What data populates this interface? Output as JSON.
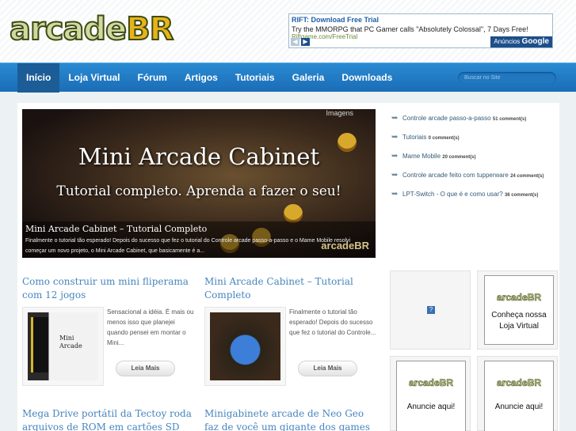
{
  "ad": {
    "title": "RIFT: Download Free Trial",
    "text": "Try the MMORPG that PC Gamer calls \"Absolutely Colossal\", 7 Days Free!",
    "url": "Riftgame.com/FreeTrial",
    "badge_prefix": "Anúncios",
    "badge_brand": "Google"
  },
  "logo": {
    "text_a": "arcade",
    "text_b": "BR"
  },
  "nav": {
    "items": [
      "Início",
      "Loja Virtual",
      "Fórum",
      "Artigos",
      "Tutoriais",
      "Galeria",
      "Downloads"
    ],
    "active_index": 0,
    "search_placeholder": "Buscar no Site"
  },
  "slider": {
    "tag": "Imagens",
    "headline": "Mini Arcade Cabinet",
    "subheadline": "Tutorial completo. Aprenda a fazer o seu!",
    "caption_title": "Mini Arcade Cabinet – Tutorial Completo",
    "caption_text": "Finalmente o tutorial tão esperado! Depois do sucesso que fez o tutorial do Controle arcade passo-a-passo e o Mame Mobile resolvi começar um novo projeto, o Mini Arcade Cabinet, que basicamente é a...",
    "watermark": "arcadeBR"
  },
  "recent": [
    {
      "title": "Controle arcade passo-a-passo",
      "comments": "51 comment(s)"
    },
    {
      "title": "Tutoriais",
      "comments": "0 comment(s)"
    },
    {
      "title": "Mame Mobile",
      "comments": "20 comment(s)"
    },
    {
      "title": "Controle arcade feito com tupperware",
      "comments": "24 comment(s)"
    },
    {
      "title": "LPT-Switch - O que é e como usar?",
      "comments": "36 comment(s)"
    }
  ],
  "posts": [
    {
      "title": "Como construir um mini fliperama com 12 jogos",
      "excerpt": "Sensacional a idéia. É mais ou menos isso que planejei quando pensei em montar o Mini...",
      "more": "Leia Mais",
      "thumb_text": "Mini Arcade"
    },
    {
      "title": "Mini Arcade Cabinet – Tutorial Completo",
      "excerpt": "Finalmente o tutorial tão esperado! Depois do sucesso que fez o tutorial do Controle...",
      "more": "Leia Mais"
    }
  ],
  "more_posts": [
    {
      "title": "Mega Drive portátil da Tectoy roda arquivos de ROM em cartões SD"
    },
    {
      "title": "Minigabinete arcade de Neo Geo faz de você um gigante dos games"
    }
  ],
  "banners": {
    "store_logo": "arcadeBR",
    "store_text_1": "Conheça nossa",
    "store_text_2": "Loja Virtual",
    "ad_logo": "arcadeBR",
    "ad_text": "Anuncie aqui!",
    "broken_icon": "?"
  }
}
